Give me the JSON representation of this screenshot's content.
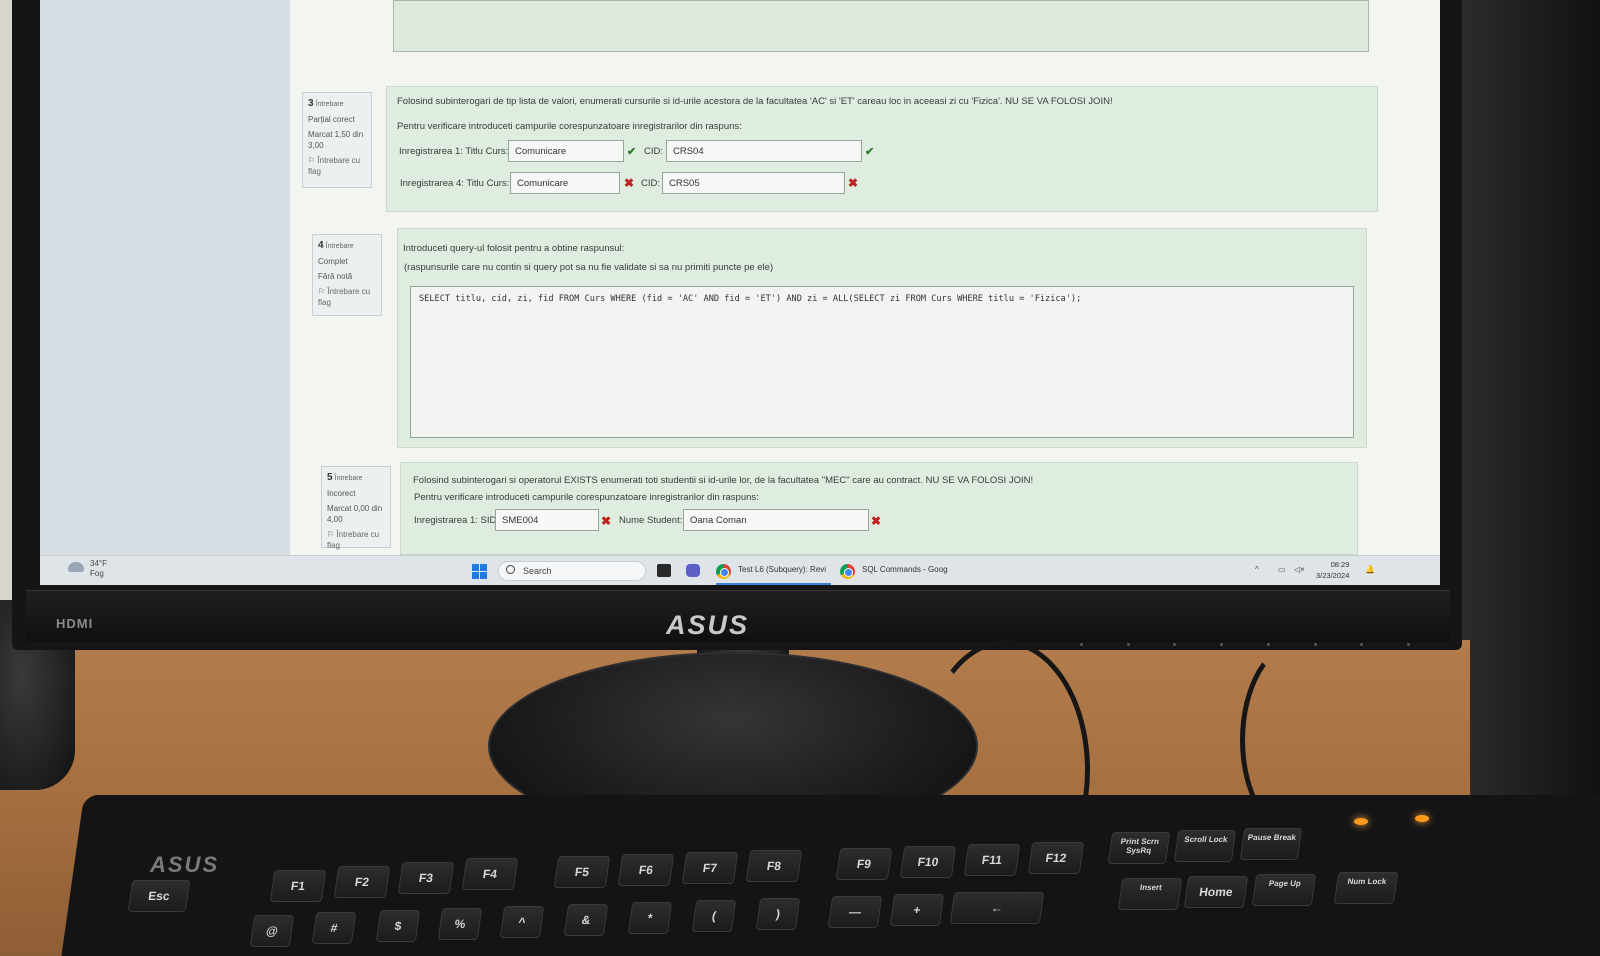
{
  "q3": {
    "number": "3",
    "word": "Întrebare",
    "state": "Parțial corect",
    "mark": "Marcat 1,50 din 3,00",
    "flag": "Întrebare cu flag",
    "text": "Folosind subinterogari de tip lista de valori, enumerati cursurile si id-urile acestora de la facultatea 'AC' si 'ET' careau loc in aceeasi zi cu 'Fizica'. NU SE VA FOLOSI JOIN!",
    "instruction": "Pentru verificare introduceti campurile corespunzatoare inregistrarilor din raspuns:",
    "rows": [
      {
        "label": "Inregistrarea 1: Titlu Curs:",
        "title": "Comunicare",
        "cid_label": "CID:",
        "cid": "CRS04"
      },
      {
        "label": "Inregistrarea 4: Titlu Curs:",
        "title": "Comunicare",
        "cid_label": "CID:",
        "cid": "CRS05"
      }
    ]
  },
  "q4": {
    "number": "4",
    "word": "Întrebare",
    "state": "Complet",
    "mark": "Fără notă",
    "flag": "Întrebare cu flag",
    "text": "Introduceti query-ul folosit pentru a obtine raspunsul:",
    "note": "(raspunsurile care nu contin si query pot sa nu fie validate si sa nu primiti puncte pe ele)",
    "sql": "SELECT titlu, cid, zi, fid FROM Curs WHERE (fid = 'AC' AND fid = 'ET') AND zi = ALL(SELECT zi FROM Curs WHERE titlu = 'Fizica');"
  },
  "q5": {
    "number": "5",
    "word": "Întrebare",
    "state": "Incorect",
    "mark": "Marcat 0,00 din 4,00",
    "flag": "Întrebare cu flag",
    "text": "Folosind subinterogari si operatorul EXISTS enumerati toti studentii si id-urile lor, de la facultatea \"MEC\" care au contract. NU SE VA FOLOSI JOIN!",
    "instruction": "Pentru verificare introduceti campurile corespunzatoare inregistrarilor din raspuns:",
    "row_label": "Inregistrarea 1: SID:",
    "sid": "SME004",
    "name_label": "Nume Student:",
    "name": "Oana Coman"
  },
  "taskbar": {
    "temp": "34°F",
    "weather": "Fog",
    "search": "Search",
    "app1": "Test L6 (Subquery): Revi",
    "app2": "SQL Commands - Goog",
    "time": "08:29",
    "date": "3/23/2024"
  },
  "monitor": {
    "port": "HDMI",
    "brand": "ASUS"
  },
  "keyboard": {
    "brand": "ASUS",
    "row_f": [
      "Esc",
      "F1",
      "F2",
      "F3",
      "F4",
      "F5",
      "F6",
      "F7",
      "F8",
      "F9",
      "F10",
      "F11",
      "F12",
      "Print Scrn SysRq",
      "Scroll Lock",
      "Pause Break"
    ],
    "row_n": [
      "@",
      "#",
      "$",
      "%",
      "^",
      "&",
      "*",
      "(",
      ")",
      "—",
      "+",
      "←",
      "Insert",
      "Home",
      "Page Up",
      "Num Lock"
    ]
  }
}
